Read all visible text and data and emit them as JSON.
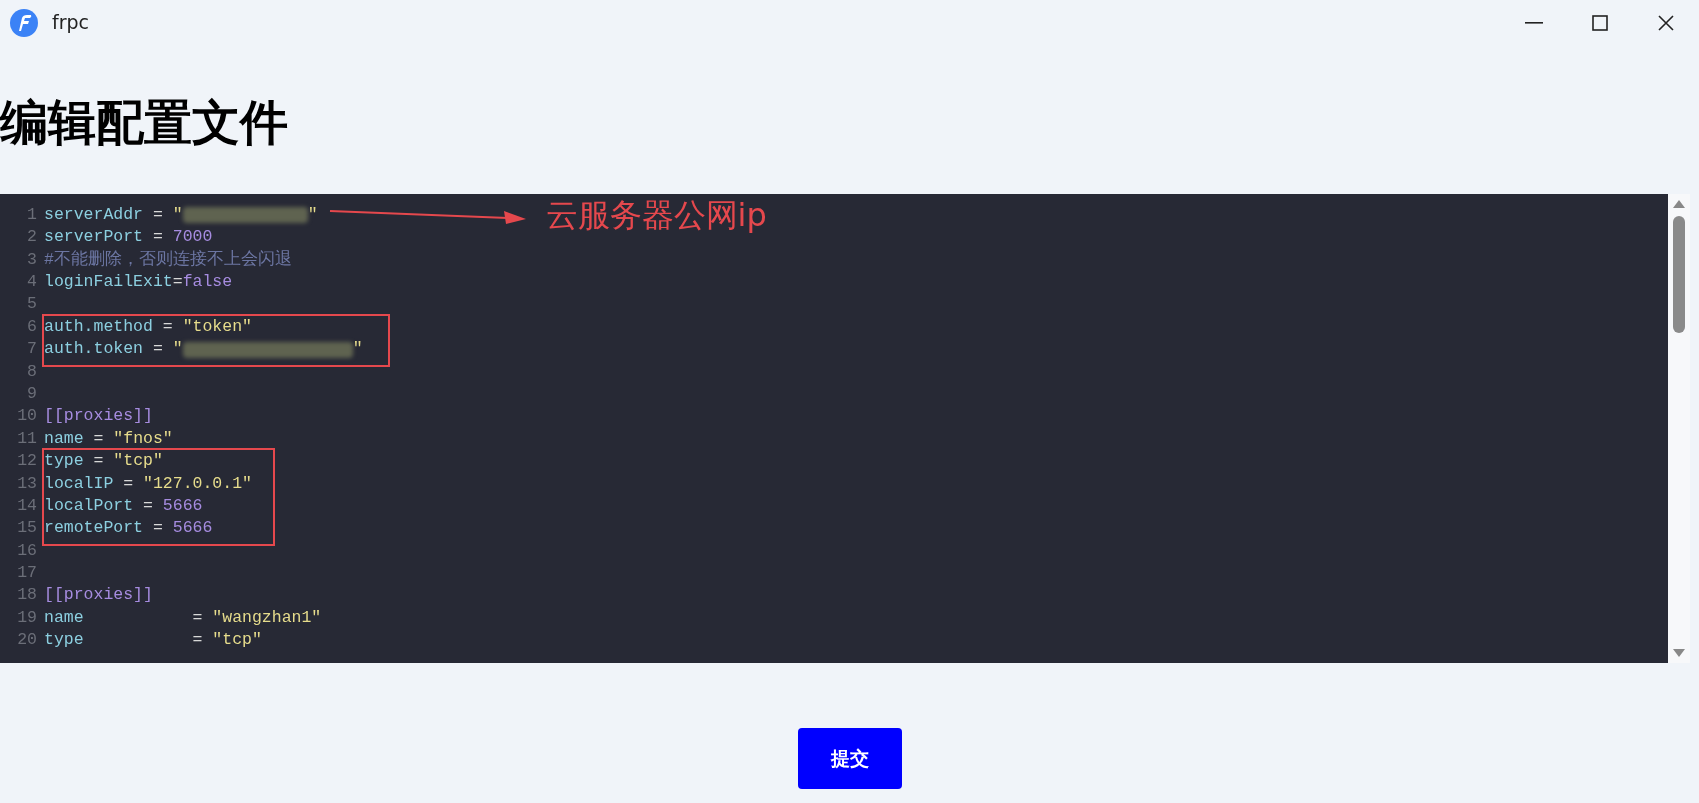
{
  "window": {
    "title": "frpc"
  },
  "heading": "编辑配置文件",
  "editor": {
    "blocks": [
      {
        "boxed": false,
        "lines": [
          {
            "number": "1",
            "segments": [
              {
                "kind": "key",
                "text": "serverAddr"
              },
              {
                "kind": "op",
                "text": " = "
              },
              {
                "kind": "string",
                "text": "\""
              },
              {
                "kind": "redacted_short"
              },
              {
                "kind": "string",
                "text": "\""
              }
            ],
            "note": "云服务器公网ip"
          },
          {
            "number": "2",
            "segments": [
              {
                "kind": "key",
                "text": "serverPort"
              },
              {
                "kind": "op",
                "text": " = "
              },
              {
                "kind": "number",
                "text": "7000"
              }
            ]
          },
          {
            "number": "3",
            "segments": [
              {
                "kind": "comment",
                "text": "#不能删除，否则连接不上会闪退"
              }
            ]
          },
          {
            "number": "4",
            "segments": [
              {
                "kind": "key",
                "text": "loginFailExit"
              },
              {
                "kind": "op",
                "text": "="
              },
              {
                "kind": "number",
                "text": "false"
              }
            ]
          },
          {
            "number": "5"
          }
        ]
      },
      {
        "boxed": true,
        "lines": [
          {
            "number": "6",
            "segments": [
              {
                "kind": "key",
                "text": "auth.method"
              },
              {
                "kind": "op",
                "text": " = "
              },
              {
                "kind": "string",
                "text": "\"token\""
              }
            ]
          },
          {
            "number": "7",
            "segments": [
              {
                "kind": "key",
                "text": "auth.token"
              },
              {
                "kind": "op",
                "text": " = "
              },
              {
                "kind": "string",
                "text": "\""
              },
              {
                "kind": "redacted_long"
              },
              {
                "kind": "string",
                "text": "\""
              }
            ]
          }
        ]
      },
      {
        "boxed": false,
        "lines": [
          {
            "number": "8"
          },
          {
            "number": "9"
          },
          {
            "number": "10",
            "segments": [
              {
                "kind": "section",
                "text": "[[proxies]]"
              }
            ]
          },
          {
            "number": "11",
            "segments": [
              {
                "kind": "key",
                "text": "name"
              },
              {
                "kind": "op",
                "text": " = "
              },
              {
                "kind": "string",
                "text": "\"fnos\""
              }
            ]
          }
        ]
      },
      {
        "boxed": true,
        "lines": [
          {
            "number": "12",
            "segments": [
              {
                "kind": "key",
                "text": "type"
              },
              {
                "kind": "op",
                "text": " = "
              },
              {
                "kind": "string",
                "text": "\"tcp\""
              }
            ]
          },
          {
            "number": "13",
            "segments": [
              {
                "kind": "key",
                "text": "localIP"
              },
              {
                "kind": "op",
                "text": " = "
              },
              {
                "kind": "string",
                "text": "\"127.0.0.1\""
              }
            ]
          },
          {
            "number": "14",
            "segments": [
              {
                "kind": "key",
                "text": "localPort"
              },
              {
                "kind": "op",
                "text": " = "
              },
              {
                "kind": "number",
                "text": "5666"
              }
            ]
          },
          {
            "number": "15",
            "segments": [
              {
                "kind": "key",
                "text": "remotePort"
              },
              {
                "kind": "op",
                "text": " = "
              },
              {
                "kind": "number",
                "text": "5666"
              }
            ]
          }
        ]
      },
      {
        "boxed": false,
        "lines": [
          {
            "number": "16"
          },
          {
            "number": "17"
          },
          {
            "number": "18",
            "segments": [
              {
                "kind": "section",
                "text": "[[proxies]]"
              }
            ]
          },
          {
            "number": "19",
            "segments": [
              {
                "kind": "key",
                "text": "name"
              },
              {
                "kind": "op",
                "text": "           = "
              },
              {
                "kind": "string",
                "text": "\"wangzhan1\""
              }
            ]
          },
          {
            "number": "20",
            "segments": [
              {
                "kind": "key",
                "text": "type"
              },
              {
                "kind": "op",
                "text": "           = "
              },
              {
                "kind": "string",
                "text": "\"tcp\""
              }
            ]
          }
        ]
      }
    ]
  },
  "submit": "提交"
}
